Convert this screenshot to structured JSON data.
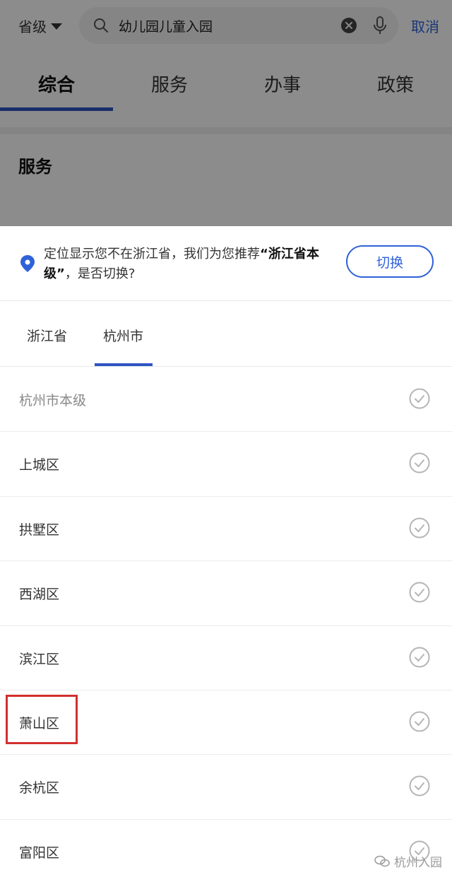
{
  "search": {
    "region_label": "省级",
    "query": "幼儿园儿童入园",
    "cancel_label": "取消"
  },
  "tabs": [
    {
      "label": "综合",
      "active": true
    },
    {
      "label": "服务",
      "active": false
    },
    {
      "label": "办事",
      "active": false
    },
    {
      "label": "政策",
      "active": false
    }
  ],
  "section_title": "服务",
  "notice": {
    "text_before": "定位显示您不在浙江省，我们为您推荐",
    "highlight": "“浙江省本级”",
    "text_after": "，是否切换?",
    "switch_label": "切换"
  },
  "level_tabs": [
    {
      "label": "浙江省",
      "active": false
    },
    {
      "label": "杭州市",
      "active": true
    }
  ],
  "districts": [
    {
      "label": "杭州市本级",
      "muted": true
    },
    {
      "label": "上城区",
      "muted": false
    },
    {
      "label": "拱墅区",
      "muted": false
    },
    {
      "label": "西湖区",
      "muted": false
    },
    {
      "label": "滨江区",
      "muted": false
    },
    {
      "label": "萧山区",
      "muted": false,
      "highlighted": true
    },
    {
      "label": "余杭区",
      "muted": false
    },
    {
      "label": "富阳区",
      "muted": false
    }
  ],
  "watermark": "杭州入园",
  "colors": {
    "accent": "#2f62d8",
    "tab_indicator": "#2f54c4",
    "highlight_box": "#d32f2f"
  }
}
